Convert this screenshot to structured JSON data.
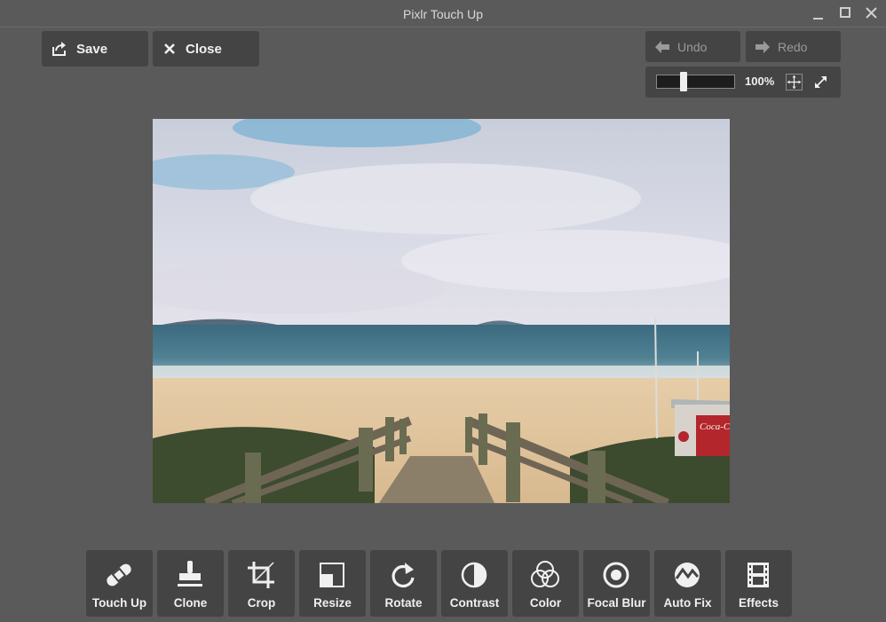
{
  "window": {
    "title": "Pixlr Touch Up"
  },
  "top_bar": {
    "save_label": "Save",
    "close_label": "Close"
  },
  "history": {
    "undo_label": "Undo",
    "redo_label": "Redo"
  },
  "zoom": {
    "value_label": "100%",
    "level": 0.33
  },
  "tools": [
    {
      "label": "Touch Up",
      "icon": "bandage-icon"
    },
    {
      "label": "Clone",
      "icon": "stamp-icon"
    },
    {
      "label": "Crop",
      "icon": "crop-icon"
    },
    {
      "label": "Resize",
      "icon": "resize-icon"
    },
    {
      "label": "Rotate",
      "icon": "rotate-icon"
    },
    {
      "label": "Contrast",
      "icon": "contrast-icon"
    },
    {
      "label": "Color",
      "icon": "color-icon"
    },
    {
      "label": "Focal Blur",
      "icon": "focal-blur-icon"
    },
    {
      "label": "Auto Fix",
      "icon": "auto-fix-icon"
    },
    {
      "label": "Effects",
      "icon": "film-icon"
    }
  ],
  "photo": {
    "sign_text": "Coca-Cola"
  },
  "colors": {
    "background": "#5a5a5a",
    "panel": "#444444",
    "text": "#f0f0f0",
    "disabled_text": "#9a9a9a"
  }
}
